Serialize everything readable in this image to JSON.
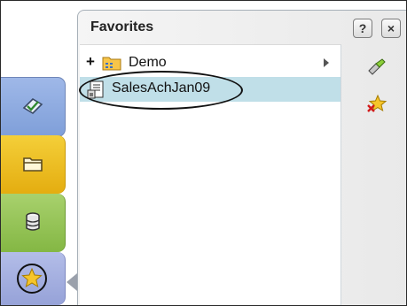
{
  "panel": {
    "title": "Favorites",
    "help_label": "?",
    "close_label": "×"
  },
  "tree": {
    "items": [
      {
        "expander": "+",
        "label": "Demo",
        "icon": "folder-icon",
        "has_submenu": true
      },
      {
        "label": "SalesAchJan09",
        "icon": "report-icon",
        "selected": true
      }
    ]
  },
  "left_tabs": [
    {
      "name": "reports",
      "icon": "document-check-icon",
      "color": "#8ea9e0"
    },
    {
      "name": "files",
      "icon": "open-folder-icon",
      "color": "#f0c020"
    },
    {
      "name": "data",
      "icon": "database-icon",
      "color": "#96c455"
    },
    {
      "name": "favorites",
      "icon": "star-icon",
      "color": "#a3aee0",
      "active": true
    }
  ],
  "side_actions": [
    {
      "icon": "go-icon"
    },
    {
      "icon": "remove-favorite-icon"
    }
  ],
  "colors": {
    "selection": "#c0dfe8",
    "panel_border": "#a7b0b8"
  }
}
